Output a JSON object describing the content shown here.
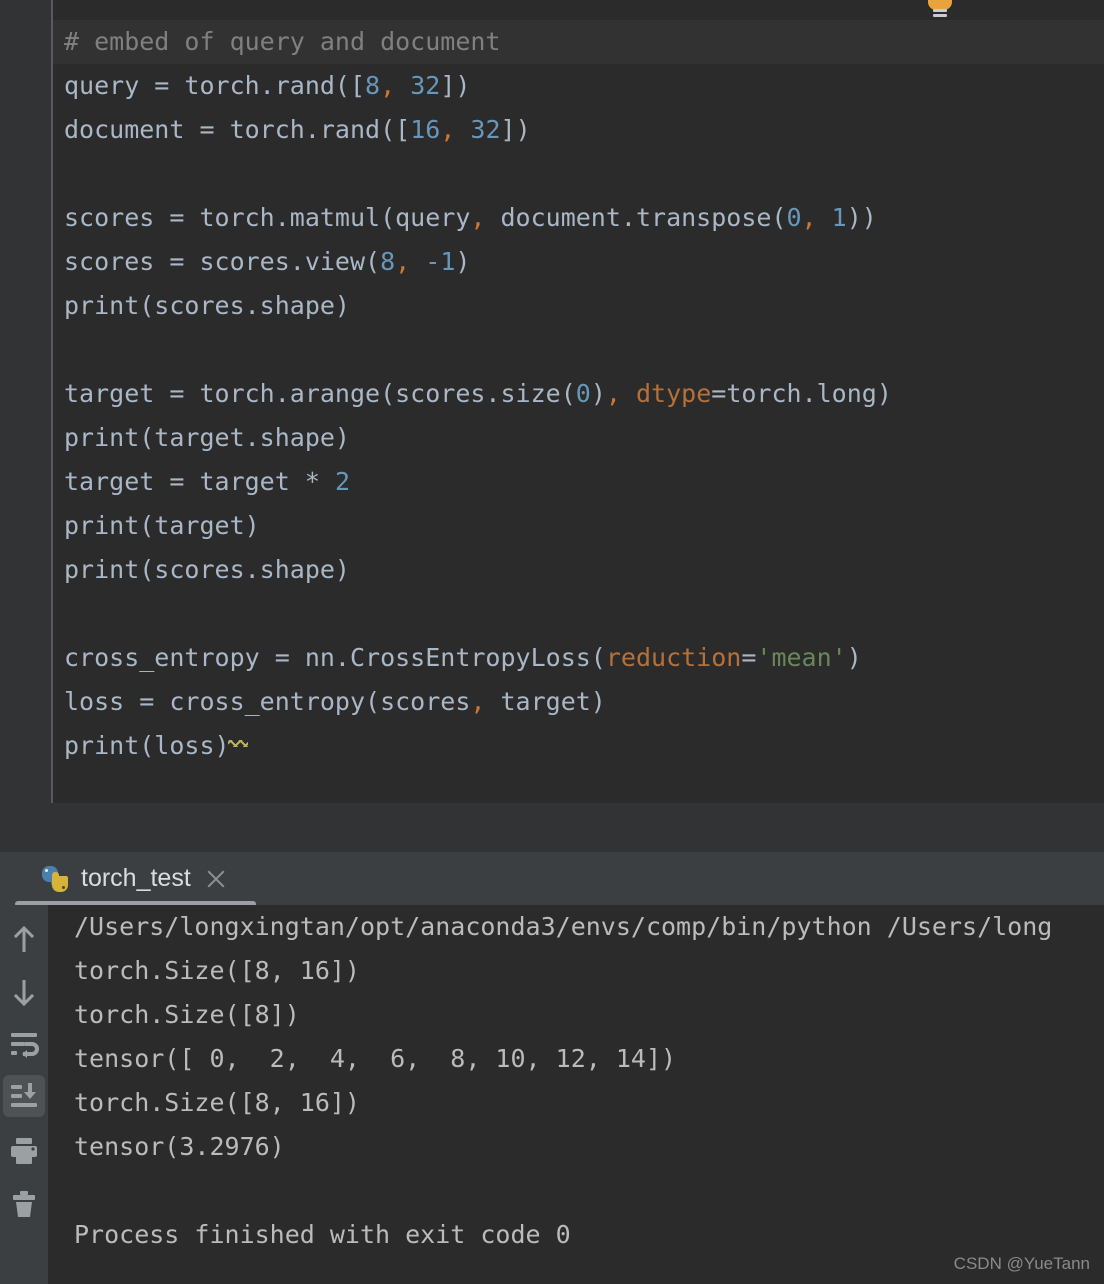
{
  "editor": {
    "intention_icon": "lightbulb-icon",
    "caret_line_index": 0,
    "lines": [
      {
        "type": "comment",
        "text": "# embed of query and document",
        "highlighted": true
      },
      {
        "type": "code",
        "segments": [
          {
            "t": "query = torch.rand([",
            "c": "plain"
          },
          {
            "t": "8",
            "c": "num"
          },
          {
            "t": ",",
            "c": "comma"
          },
          {
            "t": " ",
            "c": "plain"
          },
          {
            "t": "32",
            "c": "num"
          },
          {
            "t": "])",
            "c": "plain"
          }
        ]
      },
      {
        "type": "code",
        "segments": [
          {
            "t": "document = torch.rand([",
            "c": "plain"
          },
          {
            "t": "16",
            "c": "num"
          },
          {
            "t": ",",
            "c": "comma"
          },
          {
            "t": " ",
            "c": "plain"
          },
          {
            "t": "32",
            "c": "num"
          },
          {
            "t": "])",
            "c": "plain"
          }
        ]
      },
      {
        "type": "blank",
        "segments": []
      },
      {
        "type": "code",
        "segments": [
          {
            "t": "scores = torch.matmul(query",
            "c": "plain"
          },
          {
            "t": ",",
            "c": "comma"
          },
          {
            "t": " document.transpose(",
            "c": "plain"
          },
          {
            "t": "0",
            "c": "num"
          },
          {
            "t": ",",
            "c": "comma"
          },
          {
            "t": " ",
            "c": "plain"
          },
          {
            "t": "1",
            "c": "num"
          },
          {
            "t": "))",
            "c": "plain"
          }
        ]
      },
      {
        "type": "code",
        "segments": [
          {
            "t": "scores = scores.view(",
            "c": "plain"
          },
          {
            "t": "8",
            "c": "num"
          },
          {
            "t": ",",
            "c": "comma"
          },
          {
            "t": " ",
            "c": "plain"
          },
          {
            "t": "-1",
            "c": "num"
          },
          {
            "t": ")",
            "c": "plain"
          }
        ]
      },
      {
        "type": "code",
        "segments": [
          {
            "t": "print(scores.shape)",
            "c": "plain"
          }
        ]
      },
      {
        "type": "blank",
        "segments": []
      },
      {
        "type": "code",
        "segments": [
          {
            "t": "target = torch.arange(scores.size(",
            "c": "plain"
          },
          {
            "t": "0",
            "c": "num"
          },
          {
            "t": ")",
            "c": "plain"
          },
          {
            "t": ",",
            "c": "comma"
          },
          {
            "t": " ",
            "c": "plain"
          },
          {
            "t": "dtype",
            "c": "kwarg"
          },
          {
            "t": "=torch.long)",
            "c": "plain"
          }
        ]
      },
      {
        "type": "code",
        "segments": [
          {
            "t": "print(target.shape)",
            "c": "plain"
          }
        ]
      },
      {
        "type": "code",
        "segments": [
          {
            "t": "target = target * ",
            "c": "plain"
          },
          {
            "t": "2",
            "c": "num"
          }
        ]
      },
      {
        "type": "code",
        "segments": [
          {
            "t": "print(target)",
            "c": "plain"
          }
        ]
      },
      {
        "type": "code",
        "segments": [
          {
            "t": "print(scores.shape)",
            "c": "plain"
          }
        ]
      },
      {
        "type": "blank",
        "segments": []
      },
      {
        "type": "code",
        "segments": [
          {
            "t": "cross_entropy = nn.CrossEntropyLoss(",
            "c": "plain"
          },
          {
            "t": "reduction",
            "c": "kwarg"
          },
          {
            "t": "=",
            "c": "plain"
          },
          {
            "t": "'mean'",
            "c": "str"
          },
          {
            "t": ")",
            "c": "plain"
          }
        ]
      },
      {
        "type": "code",
        "segments": [
          {
            "t": "loss = cross_entropy(scores",
            "c": "plain"
          },
          {
            "t": ",",
            "c": "comma"
          },
          {
            "t": " target)",
            "c": "plain"
          }
        ]
      },
      {
        "type": "code",
        "squiggly": true,
        "segments": [
          {
            "t": "print(loss)",
            "c": "plain"
          }
        ]
      }
    ]
  },
  "run_window": {
    "tab": {
      "icon": "python-file-icon",
      "label": "torch_test",
      "close_icon": "close-icon",
      "active": true
    },
    "toolbar": [
      {
        "name": "up-arrow-icon",
        "label": "Up the Stack Trace",
        "selected": false
      },
      {
        "name": "down-arrow-icon",
        "label": "Down the Stack Trace",
        "selected": false
      },
      {
        "name": "soft-wrap-icon",
        "label": "Soft-Wrap",
        "selected": false
      },
      {
        "name": "scroll-to-end-icon",
        "label": "Scroll to End",
        "selected": true
      },
      {
        "name": "print-icon",
        "label": "Print",
        "selected": false
      },
      {
        "name": "trash-icon",
        "label": "Clear All",
        "selected": false
      }
    ],
    "console_lines": [
      "/Users/longxingtan/opt/anaconda3/envs/comp/bin/python /Users/long",
      "torch.Size([8, 16])",
      "torch.Size([8])",
      "tensor([ 0,  2,  4,  6,  8, 10, 12, 14])",
      "torch.Size([8, 16])",
      "tensor(3.2976)",
      "",
      "Process finished with exit code 0"
    ]
  },
  "watermark": "CSDN @YueTann",
  "colors": {
    "editor_bg": "#2b2b2b",
    "gutter_bg": "#313335",
    "panel_bg": "#3c3f41",
    "text": "#a9b7c6",
    "comment": "#808080",
    "number": "#6897bb",
    "keyword_arg": "#b5713b",
    "string": "#6a8759",
    "comma": "#cc7832",
    "console_text": "#bbbbbb",
    "bulb": "#e8a33d",
    "selected_tool": "#4e5254"
  }
}
